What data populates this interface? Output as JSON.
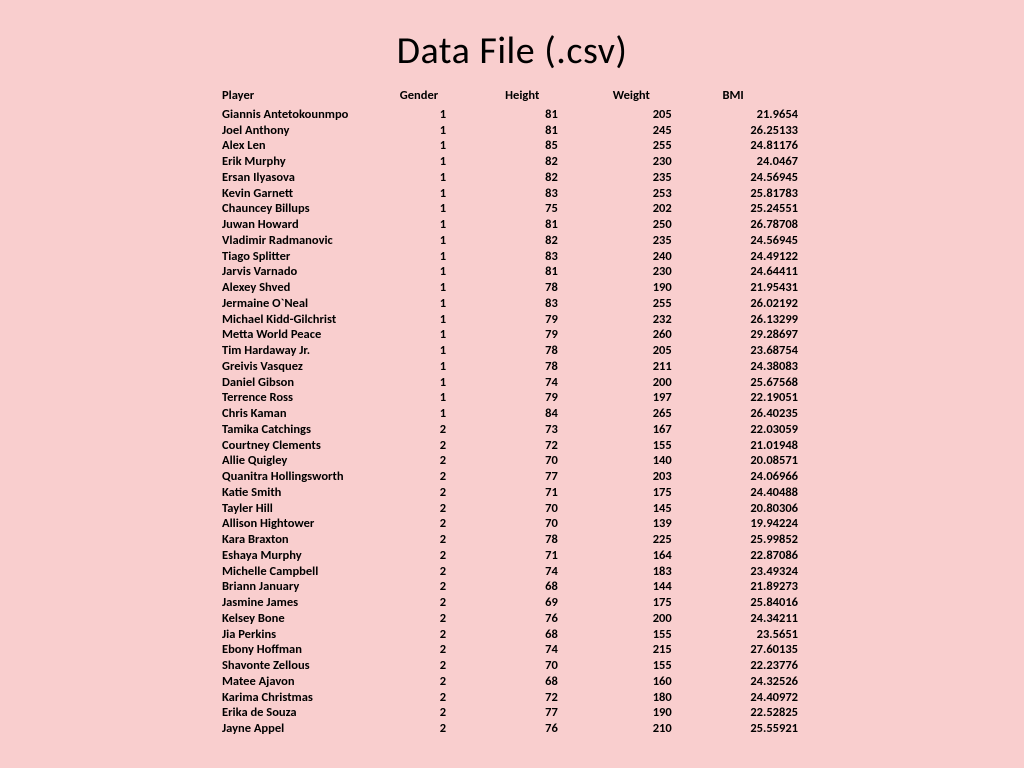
{
  "title": "Data File (.csv)",
  "columns": [
    "Player",
    "Gender",
    "Height",
    "Weight",
    "BMI"
  ],
  "rows": [
    {
      "player": "Giannis Antetokounmpo",
      "gender": "1",
      "height": "81",
      "weight": "205",
      "bmi": "21.9654"
    },
    {
      "player": "Joel Anthony",
      "gender": "1",
      "height": "81",
      "weight": "245",
      "bmi": "26.25133"
    },
    {
      "player": "Alex Len",
      "gender": "1",
      "height": "85",
      "weight": "255",
      "bmi": "24.81176"
    },
    {
      "player": "Erik Murphy",
      "gender": "1",
      "height": "82",
      "weight": "230",
      "bmi": "24.0467"
    },
    {
      "player": "Ersan Ilyasova",
      "gender": "1",
      "height": "82",
      "weight": "235",
      "bmi": "24.56945"
    },
    {
      "player": "Kevin Garnett",
      "gender": "1",
      "height": "83",
      "weight": "253",
      "bmi": "25.81783"
    },
    {
      "player": "Chauncey Billups",
      "gender": "1",
      "height": "75",
      "weight": "202",
      "bmi": "25.24551"
    },
    {
      "player": "Juwan Howard",
      "gender": "1",
      "height": "81",
      "weight": "250",
      "bmi": "26.78708"
    },
    {
      "player": "Vladimir Radmanovic",
      "gender": "1",
      "height": "82",
      "weight": "235",
      "bmi": "24.56945"
    },
    {
      "player": "Tiago Splitter",
      "gender": "1",
      "height": "83",
      "weight": "240",
      "bmi": "24.49122"
    },
    {
      "player": "Jarvis Varnado",
      "gender": "1",
      "height": "81",
      "weight": "230",
      "bmi": "24.64411"
    },
    {
      "player": "Alexey Shved",
      "gender": "1",
      "height": "78",
      "weight": "190",
      "bmi": "21.95431"
    },
    {
      "player": "Jermaine O`Neal",
      "gender": "1",
      "height": "83",
      "weight": "255",
      "bmi": "26.02192"
    },
    {
      "player": "Michael Kidd-Gilchrist",
      "gender": "1",
      "height": "79",
      "weight": "232",
      "bmi": "26.13299"
    },
    {
      "player": "Metta World Peace",
      "gender": "1",
      "height": "79",
      "weight": "260",
      "bmi": "29.28697"
    },
    {
      "player": "Tim Hardaway Jr.",
      "gender": "1",
      "height": "78",
      "weight": "205",
      "bmi": "23.68754"
    },
    {
      "player": "Greivis Vasquez",
      "gender": "1",
      "height": "78",
      "weight": "211",
      "bmi": "24.38083"
    },
    {
      "player": "Daniel Gibson",
      "gender": "1",
      "height": "74",
      "weight": "200",
      "bmi": "25.67568"
    },
    {
      "player": "Terrence Ross",
      "gender": "1",
      "height": "79",
      "weight": "197",
      "bmi": "22.19051"
    },
    {
      "player": "Chris Kaman",
      "gender": "1",
      "height": "84",
      "weight": "265",
      "bmi": "26.40235"
    },
    {
      "player": "Tamika Catchings",
      "gender": "2",
      "height": "73",
      "weight": "167",
      "bmi": "22.03059"
    },
    {
      "player": "Courtney Clements",
      "gender": "2",
      "height": "72",
      "weight": "155",
      "bmi": "21.01948"
    },
    {
      "player": "Allie Quigley",
      "gender": "2",
      "height": "70",
      "weight": "140",
      "bmi": "20.08571"
    },
    {
      "player": "Quanitra Hollingsworth",
      "gender": "2",
      "height": "77",
      "weight": "203",
      "bmi": "24.06966"
    },
    {
      "player": "Katie Smith",
      "gender": "2",
      "height": "71",
      "weight": "175",
      "bmi": "24.40488"
    },
    {
      "player": "Tayler Hill",
      "gender": "2",
      "height": "70",
      "weight": "145",
      "bmi": "20.80306"
    },
    {
      "player": "Allison Hightower",
      "gender": "2",
      "height": "70",
      "weight": "139",
      "bmi": "19.94224"
    },
    {
      "player": "Kara Braxton",
      "gender": "2",
      "height": "78",
      "weight": "225",
      "bmi": "25.99852"
    },
    {
      "player": "Eshaya Murphy",
      "gender": "2",
      "height": "71",
      "weight": "164",
      "bmi": "22.87086"
    },
    {
      "player": "Michelle Campbell",
      "gender": "2",
      "height": "74",
      "weight": "183",
      "bmi": "23.49324"
    },
    {
      "player": "Briann January",
      "gender": "2",
      "height": "68",
      "weight": "144",
      "bmi": "21.89273"
    },
    {
      "player": "Jasmine James",
      "gender": "2",
      "height": "69",
      "weight": "175",
      "bmi": "25.84016"
    },
    {
      "player": "Kelsey Bone",
      "gender": "2",
      "height": "76",
      "weight": "200",
      "bmi": "24.34211"
    },
    {
      "player": "Jia Perkins",
      "gender": "2",
      "height": "68",
      "weight": "155",
      "bmi": "23.5651"
    },
    {
      "player": "Ebony Hoffman",
      "gender": "2",
      "height": "74",
      "weight": "215",
      "bmi": "27.60135"
    },
    {
      "player": "Shavonte Zellous",
      "gender": "2",
      "height": "70",
      "weight": "155",
      "bmi": "22.23776"
    },
    {
      "player": "Matee Ajavon",
      "gender": "2",
      "height": "68",
      "weight": "160",
      "bmi": "24.32526"
    },
    {
      "player": "Karima Christmas",
      "gender": "2",
      "height": "72",
      "weight": "180",
      "bmi": "24.40972"
    },
    {
      "player": "Erika de Souza",
      "gender": "2",
      "height": "77",
      "weight": "190",
      "bmi": "22.52825"
    },
    {
      "player": "Jayne Appel",
      "gender": "2",
      "height": "76",
      "weight": "210",
      "bmi": "25.55921"
    }
  ]
}
